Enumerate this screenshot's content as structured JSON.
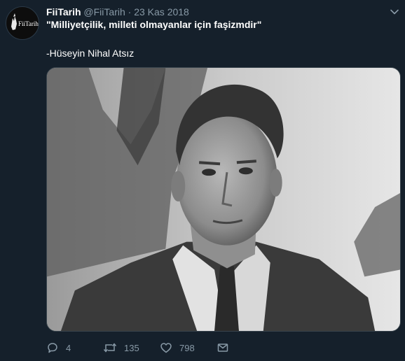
{
  "tweet": {
    "author_name": "FiiTarih",
    "handle": "@FiiTarih",
    "separator": "·",
    "date": "23 Kas 2018",
    "quote": "\"Milliyetçilik, milleti olmayanlar için faşizmdir\"",
    "attribution": "-Hüseyin Nihal Atsız",
    "avatar_text": "FiiTarih"
  },
  "actions": {
    "reply_count": "4",
    "retweet_count": "135",
    "like_count": "798"
  },
  "icons": {
    "caret": "chevron-down-icon",
    "reply": "comment-icon",
    "retweet": "retweet-icon",
    "like": "heart-icon",
    "dm": "envelope-icon"
  },
  "colors": {
    "background": "#15202b",
    "secondary_text": "#8899a6",
    "primary_text": "#ffffff"
  }
}
